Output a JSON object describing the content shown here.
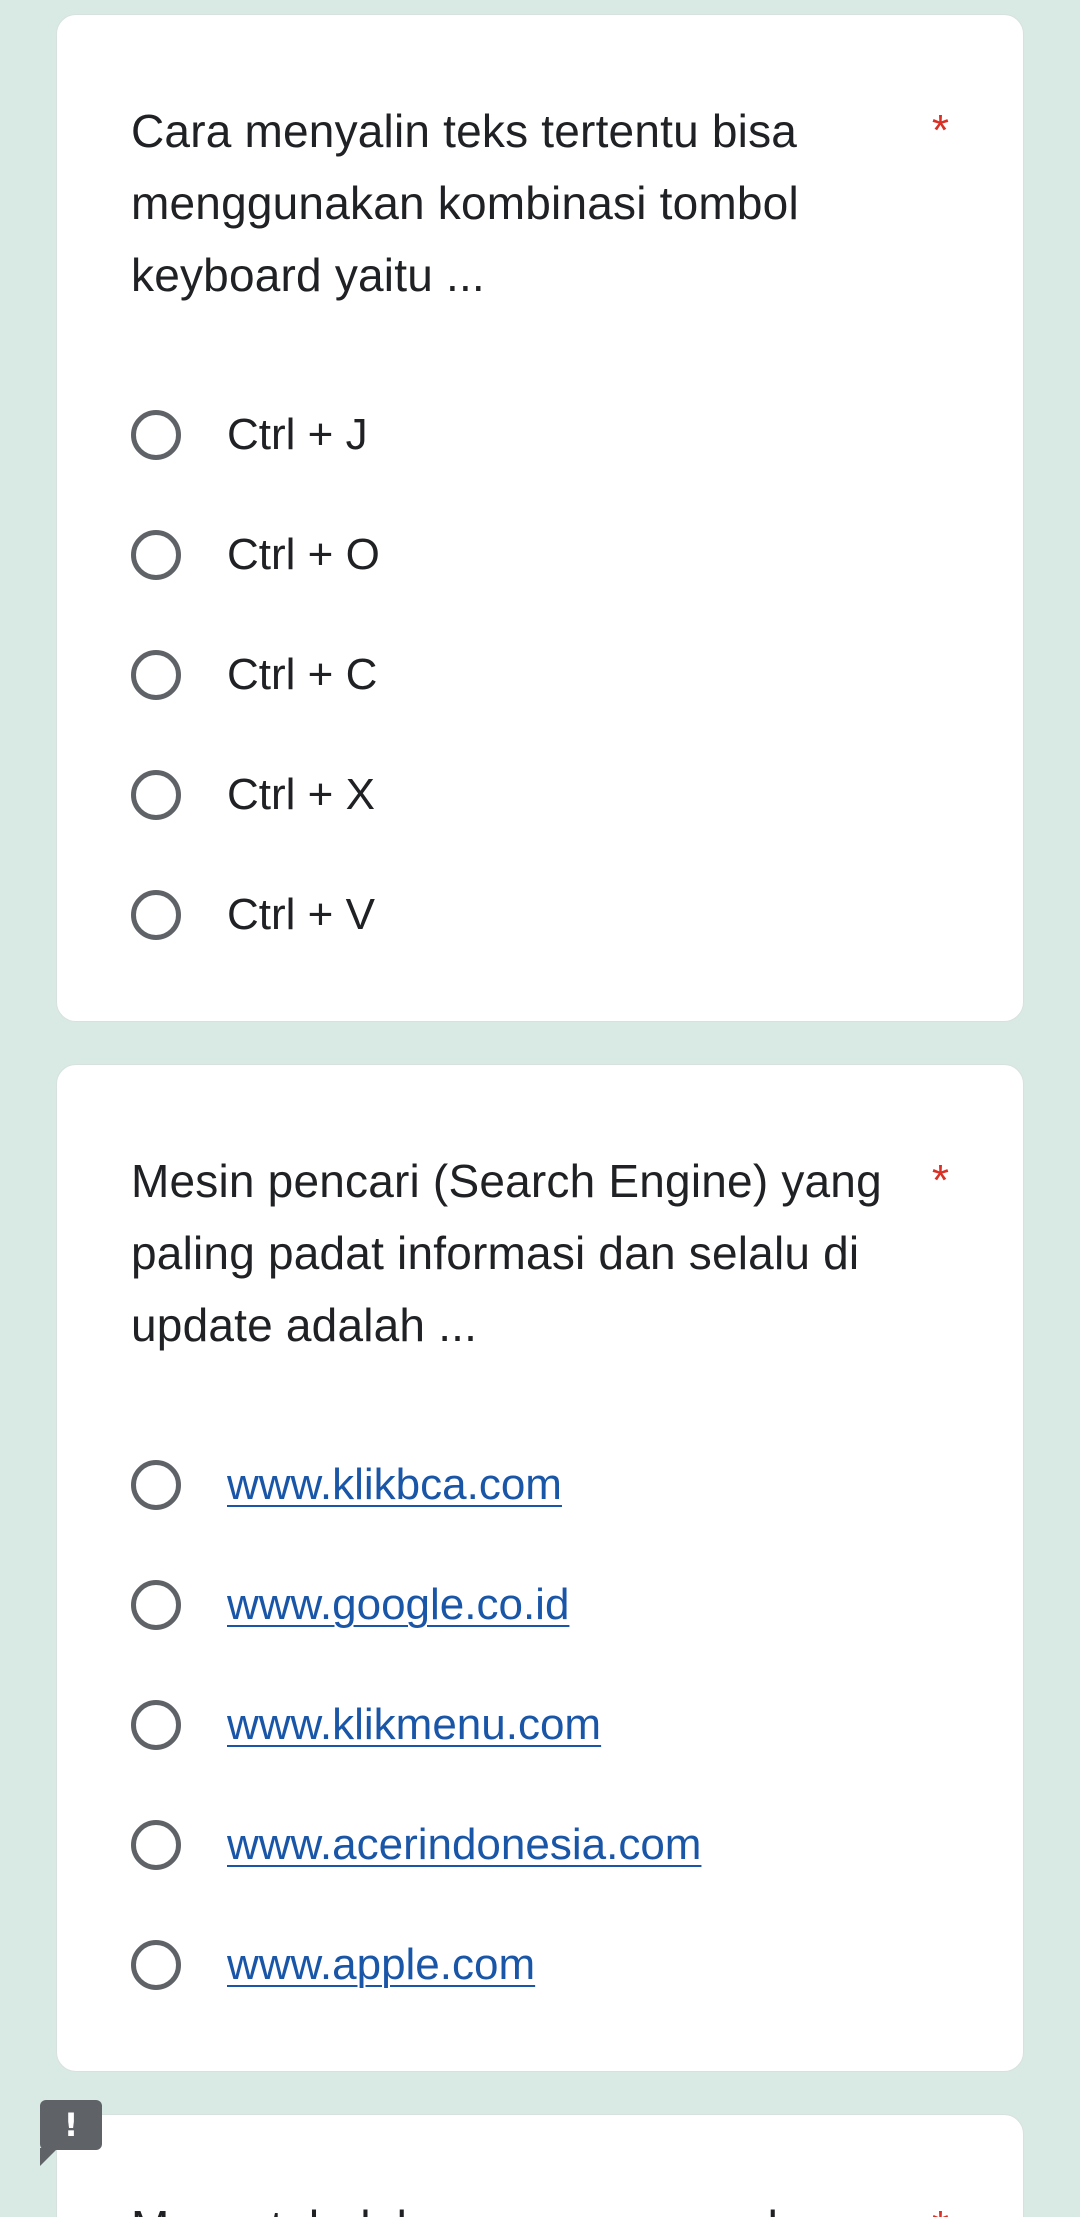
{
  "questions": [
    {
      "text": "Cara menyalin teks tertentu bisa menggunakan kombinasi tombol keyboard yaitu ...",
      "required_mark": "*",
      "options": [
        "Ctrl + J",
        "Ctrl + O",
        "Ctrl + C",
        "Ctrl + X",
        "Ctrl + V"
      ]
    },
    {
      "text": "Mesin pencari (Search Engine) yang paling padat informasi dan selalu di update adalah ...",
      "required_mark": "*",
      "options": [
        "www.klikbca.com",
        "www.google.co.id",
        "www.klikmenu.com",
        "www.acerindonesia.com",
        "www.apple.com"
      ]
    },
    {
      "text": "Mencetak dokumen menggunakan",
      "required_mark": "*"
    }
  ],
  "feedback": {
    "icon": "report-issue-icon",
    "glyph": "!"
  },
  "colors": {
    "background": "#d9e9e3",
    "card": "#ffffff",
    "required": "#d93025",
    "link": "#1a56a8",
    "radio_border": "#5f6368"
  }
}
